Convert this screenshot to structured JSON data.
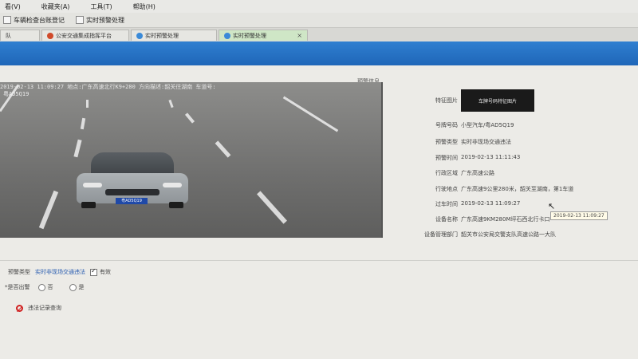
{
  "menubar": {
    "items": [
      "看(V)",
      "收藏夹(A)",
      "工具(T)",
      "帮助(H)"
    ]
  },
  "toolbar": {
    "buttons": [
      "车辆检查台账登记",
      "实时预警处理"
    ]
  },
  "tabs": [
    {
      "label": "队",
      "active": false
    },
    {
      "label": "公安交通集成指挥平台",
      "active": false
    },
    {
      "label": "实时预警处理",
      "active": false
    },
    {
      "label": "实时预警处理",
      "active": true,
      "close": "×"
    }
  ],
  "section_title": "预警信息",
  "photo": {
    "ocr_line1": "2019-02-13 11:09:27 地点:广东高速北行K9+280 方向描述:韶关往湖南 车道号:",
    "ocr_line2": "粤AD5Q19",
    "plate_text": "粤AD5Q19"
  },
  "details": {
    "plate_image": {
      "label": "特征图片",
      "text": "车牌号码特征图片"
    },
    "fields": [
      {
        "label": "号牌号码",
        "value": "小型汽车/粤AD5Q19"
      },
      {
        "label": "预警类型",
        "value": "实时非现场交通违法"
      },
      {
        "label": "预警时间",
        "value": "2019-02-13 11:11:43"
      },
      {
        "label": "行政区域",
        "value": "广东高速公路"
      },
      {
        "label": "行驶地点",
        "value": "广东高速9公里280米，韶关至湖南，第1车道"
      },
      {
        "label": "过车时间",
        "value": "2019-02-13 11:09:27"
      },
      {
        "label": "设备名称",
        "value": "广东高速9KM280M坪石西北行卡口"
      },
      {
        "label": "设备管理部门",
        "value": "韶关市公安局交警支队高速公路一大队"
      }
    ],
    "tooltip": "2019-02-13 11:09:27"
  },
  "form": {
    "type_label": "预警类型",
    "type_value": "实时非现场交通违法",
    "valid_label": "有效",
    "valid_checked": true,
    "dispatch_label": "*是否出警",
    "option_no": "否",
    "option_yes": "是",
    "query_label": "违法记录查询"
  },
  "colors": {
    "accent_blue": "#1f66b8",
    "active_tab": "#cfe6c6",
    "alert_red": "#d02020"
  }
}
